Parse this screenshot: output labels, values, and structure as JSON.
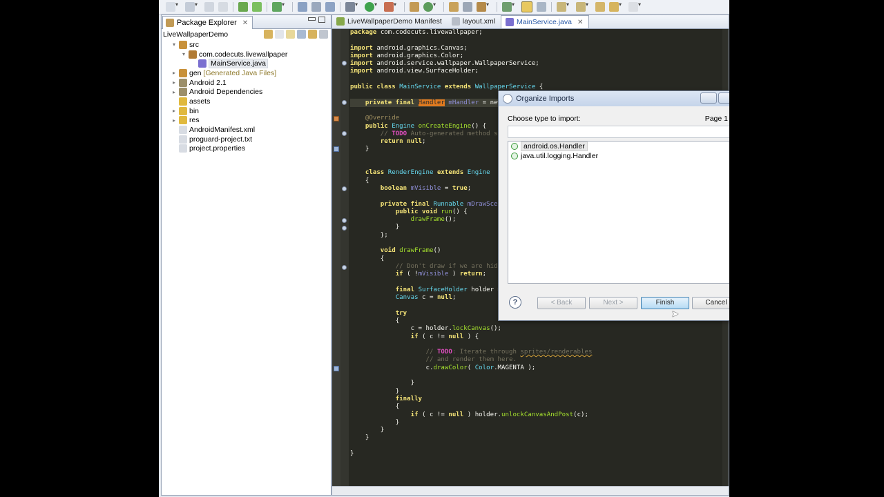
{
  "package_explorer": {
    "tab_title": "Package Explorer",
    "project": "LiveWallpaperDemo",
    "tree": [
      {
        "label": "src",
        "decor": "",
        "twisty": "▾",
        "indent": 1,
        "icon_color": "#c8913a",
        "selected": false
      },
      {
        "label": "com.codecuts.livewallpaper",
        "decor": "",
        "twisty": "▾",
        "indent": 2,
        "icon_color": "#b07a35",
        "selected": false
      },
      {
        "label": "MainService.java",
        "decor": "",
        "twisty": "",
        "indent": 3,
        "icon_color": "#7a6fd0",
        "selected": true
      },
      {
        "label": "gen",
        "decor": "[Generated Java Files]",
        "twisty": "▸",
        "indent": 1,
        "icon_color": "#c8913a",
        "selected": false
      },
      {
        "label": "Android 2.1",
        "decor": "",
        "twisty": "▸",
        "indent": 1,
        "icon_color": "#9c8f6a",
        "selected": false
      },
      {
        "label": "Android Dependencies",
        "decor": "",
        "twisty": "▸",
        "indent": 1,
        "icon_color": "#9c8f6a",
        "selected": false
      },
      {
        "label": "assets",
        "decor": "",
        "twisty": "",
        "indent": 1,
        "icon_color": "#e0b93e",
        "selected": false
      },
      {
        "label": "bin",
        "decor": "",
        "twisty": "▸",
        "indent": 1,
        "icon_color": "#e0b93e",
        "selected": false
      },
      {
        "label": "res",
        "decor": "",
        "twisty": "▸",
        "indent": 1,
        "icon_color": "#e0b93e",
        "selected": false
      },
      {
        "label": "AndroidManifest.xml",
        "decor": "",
        "twisty": "",
        "indent": 1,
        "icon_color": "#d8dce3",
        "selected": false
      },
      {
        "label": "proguard-project.txt",
        "decor": "",
        "twisty": "",
        "indent": 1,
        "icon_color": "#d8dce3",
        "selected": false
      },
      {
        "label": "project.properties",
        "decor": "",
        "twisty": "",
        "indent": 1,
        "icon_color": "#d8dce3",
        "selected": false
      }
    ]
  },
  "editor": {
    "tabs": [
      {
        "label": "LiveWallpaperDemo Manifest",
        "active": false,
        "icon_color": "#86a84a"
      },
      {
        "label": "layout.xml",
        "active": false,
        "icon_color": "#b8bec8"
      },
      {
        "label": "MainService.java",
        "active": true,
        "icon_color": "#7a6fd0"
      }
    ],
    "code_lines": [
      [
        [
          "package ",
          "kw"
        ],
        [
          "com.codecuts.livewallpaper;",
          ""
        ]
      ],
      [],
      [
        [
          "import ",
          "kw"
        ],
        [
          "android.graphics.Canvas;",
          ""
        ]
      ],
      [
        [
          "import ",
          "kw"
        ],
        [
          "android.graphics.Color;",
          ""
        ]
      ],
      [
        [
          "import ",
          "kw"
        ],
        [
          "android.service.wallpaper.WallpaperService;",
          ""
        ]
      ],
      [
        [
          "import ",
          "kw"
        ],
        [
          "android.view.SurfaceHolder;",
          ""
        ]
      ],
      [],
      [
        [
          "public class ",
          "kw"
        ],
        [
          "MainService ",
          "ty"
        ],
        [
          "extends ",
          "kw"
        ],
        [
          "WallpaperService ",
          "ty"
        ],
        [
          "{",
          ""
        ]
      ],
      [],
      [
        [
          "    private final ",
          "kw"
        ],
        [
          "Handler",
          "hl"
        ],
        [
          " ",
          ""
        ],
        [
          "mHandler",
          "fd"
        ],
        [
          " = new",
          ""
        ]
      ],
      [],
      [
        [
          "    @Override",
          "an"
        ]
      ],
      [
        [
          "    public ",
          "kw"
        ],
        [
          "Engine ",
          "ty"
        ],
        [
          "onCreateEngine",
          "fn"
        ],
        [
          "() {",
          ""
        ]
      ],
      [
        [
          "        // ",
          "cm"
        ],
        [
          "TODO",
          "td"
        ],
        [
          " Auto-generated method st",
          "cm"
        ]
      ],
      [
        [
          "        return null",
          "kw"
        ],
        [
          ";",
          ""
        ]
      ],
      [
        [
          "    }",
          ""
        ]
      ],
      [],
      [],
      [
        [
          "    class ",
          "kw"
        ],
        [
          "RenderEngine ",
          "ty"
        ],
        [
          "extends ",
          "kw"
        ],
        [
          "Engine",
          "ty"
        ]
      ],
      [
        [
          "    {",
          ""
        ]
      ],
      [
        [
          "        boolean ",
          "kw"
        ],
        [
          "mVisible",
          "fd"
        ],
        [
          " = ",
          ""
        ],
        [
          "true",
          "kw"
        ],
        [
          ";",
          ""
        ]
      ],
      [],
      [
        [
          "        private final ",
          "kw"
        ],
        [
          "Runnable ",
          "ty"
        ],
        [
          "mDrawScene",
          "fd"
        ]
      ],
      [
        [
          "            public void ",
          "kw"
        ],
        [
          "run",
          "fn"
        ],
        [
          "() {",
          ""
        ]
      ],
      [
        [
          "                drawFrame",
          "fn"
        ],
        [
          "();",
          ""
        ]
      ],
      [
        [
          "            }",
          ""
        ]
      ],
      [
        [
          "        };",
          ""
        ]
      ],
      [],
      [
        [
          "        void ",
          "kw"
        ],
        [
          "drawFrame",
          "fn"
        ],
        [
          "()",
          ""
        ]
      ],
      [
        [
          "        {",
          ""
        ]
      ],
      [
        [
          "            // Don't draw if we are hidd",
          "cm"
        ]
      ],
      [
        [
          "            if ",
          "kw"
        ],
        [
          "( !",
          ""
        ],
        [
          "mVisible",
          "fd"
        ],
        [
          " ) ",
          ""
        ],
        [
          "return",
          "kw"
        ],
        [
          ";",
          ""
        ]
      ],
      [],
      [
        [
          "            final ",
          "kw"
        ],
        [
          "SurfaceHolder ",
          "ty"
        ],
        [
          "holder =",
          ""
        ]
      ],
      [
        [
          "            Canvas ",
          "ty"
        ],
        [
          "c = ",
          ""
        ],
        [
          "null",
          "kw"
        ],
        [
          ";",
          ""
        ]
      ],
      [],
      [
        [
          "            try",
          "kw"
        ]
      ],
      [
        [
          "            {",
          ""
        ]
      ],
      [
        [
          "                c = holder.",
          ""
        ],
        [
          "lockCanvas",
          "fn"
        ],
        [
          "();",
          ""
        ]
      ],
      [
        [
          "                if ",
          "kw"
        ],
        [
          "( c != ",
          ""
        ],
        [
          "null",
          "kw"
        ],
        [
          " ) {",
          ""
        ]
      ],
      [],
      [
        [
          "                    // ",
          "cm"
        ],
        [
          "TODO",
          "td"
        ],
        [
          ": Iterate through ",
          "cm"
        ],
        [
          "sprites/renderables",
          "cm ul"
        ]
      ],
      [
        [
          "                    // and render them here.",
          "cm"
        ]
      ],
      [
        [
          "                    c.",
          ""
        ],
        [
          "drawColor",
          "fn"
        ],
        [
          "( ",
          ""
        ],
        [
          "Color",
          "ty"
        ],
        [
          ".MAGENTA );",
          ""
        ]
      ],
      [],
      [
        [
          "                }",
          ""
        ]
      ],
      [
        [
          "            }",
          ""
        ]
      ],
      [
        [
          "            finally",
          "kw"
        ]
      ],
      [
        [
          "            {",
          ""
        ]
      ],
      [
        [
          "                if ",
          "kw"
        ],
        [
          "( c != ",
          ""
        ],
        [
          "null",
          "kw"
        ],
        [
          " ) holder.",
          ""
        ],
        [
          "unlockCanvasAndPost",
          "fn"
        ],
        [
          "(c);",
          ""
        ]
      ],
      [
        [
          "            }",
          ""
        ]
      ],
      [
        [
          "        }",
          ""
        ]
      ],
      [
        [
          "    }",
          ""
        ]
      ],
      [],
      [
        [
          "}",
          ""
        ]
      ]
    ]
  },
  "dialog": {
    "title": "Organize Imports",
    "prompt": "Choose type to import:",
    "page": "Page 1",
    "filter_value": "",
    "options": [
      {
        "label": "android.os.Handler",
        "selected": true
      },
      {
        "label": "java.util.logging.Handler",
        "selected": false
      }
    ],
    "buttons": {
      "back": "< Back",
      "next": "Next >",
      "finish": "Finish",
      "cancel": "Cancel"
    },
    "help": "?"
  },
  "colors": {
    "editor_bg": "#272822",
    "keyword": "#f5e478",
    "type": "#66d9ef",
    "method": "#a6e22e",
    "comment": "#75715e",
    "highlight": "#e07a1f"
  }
}
